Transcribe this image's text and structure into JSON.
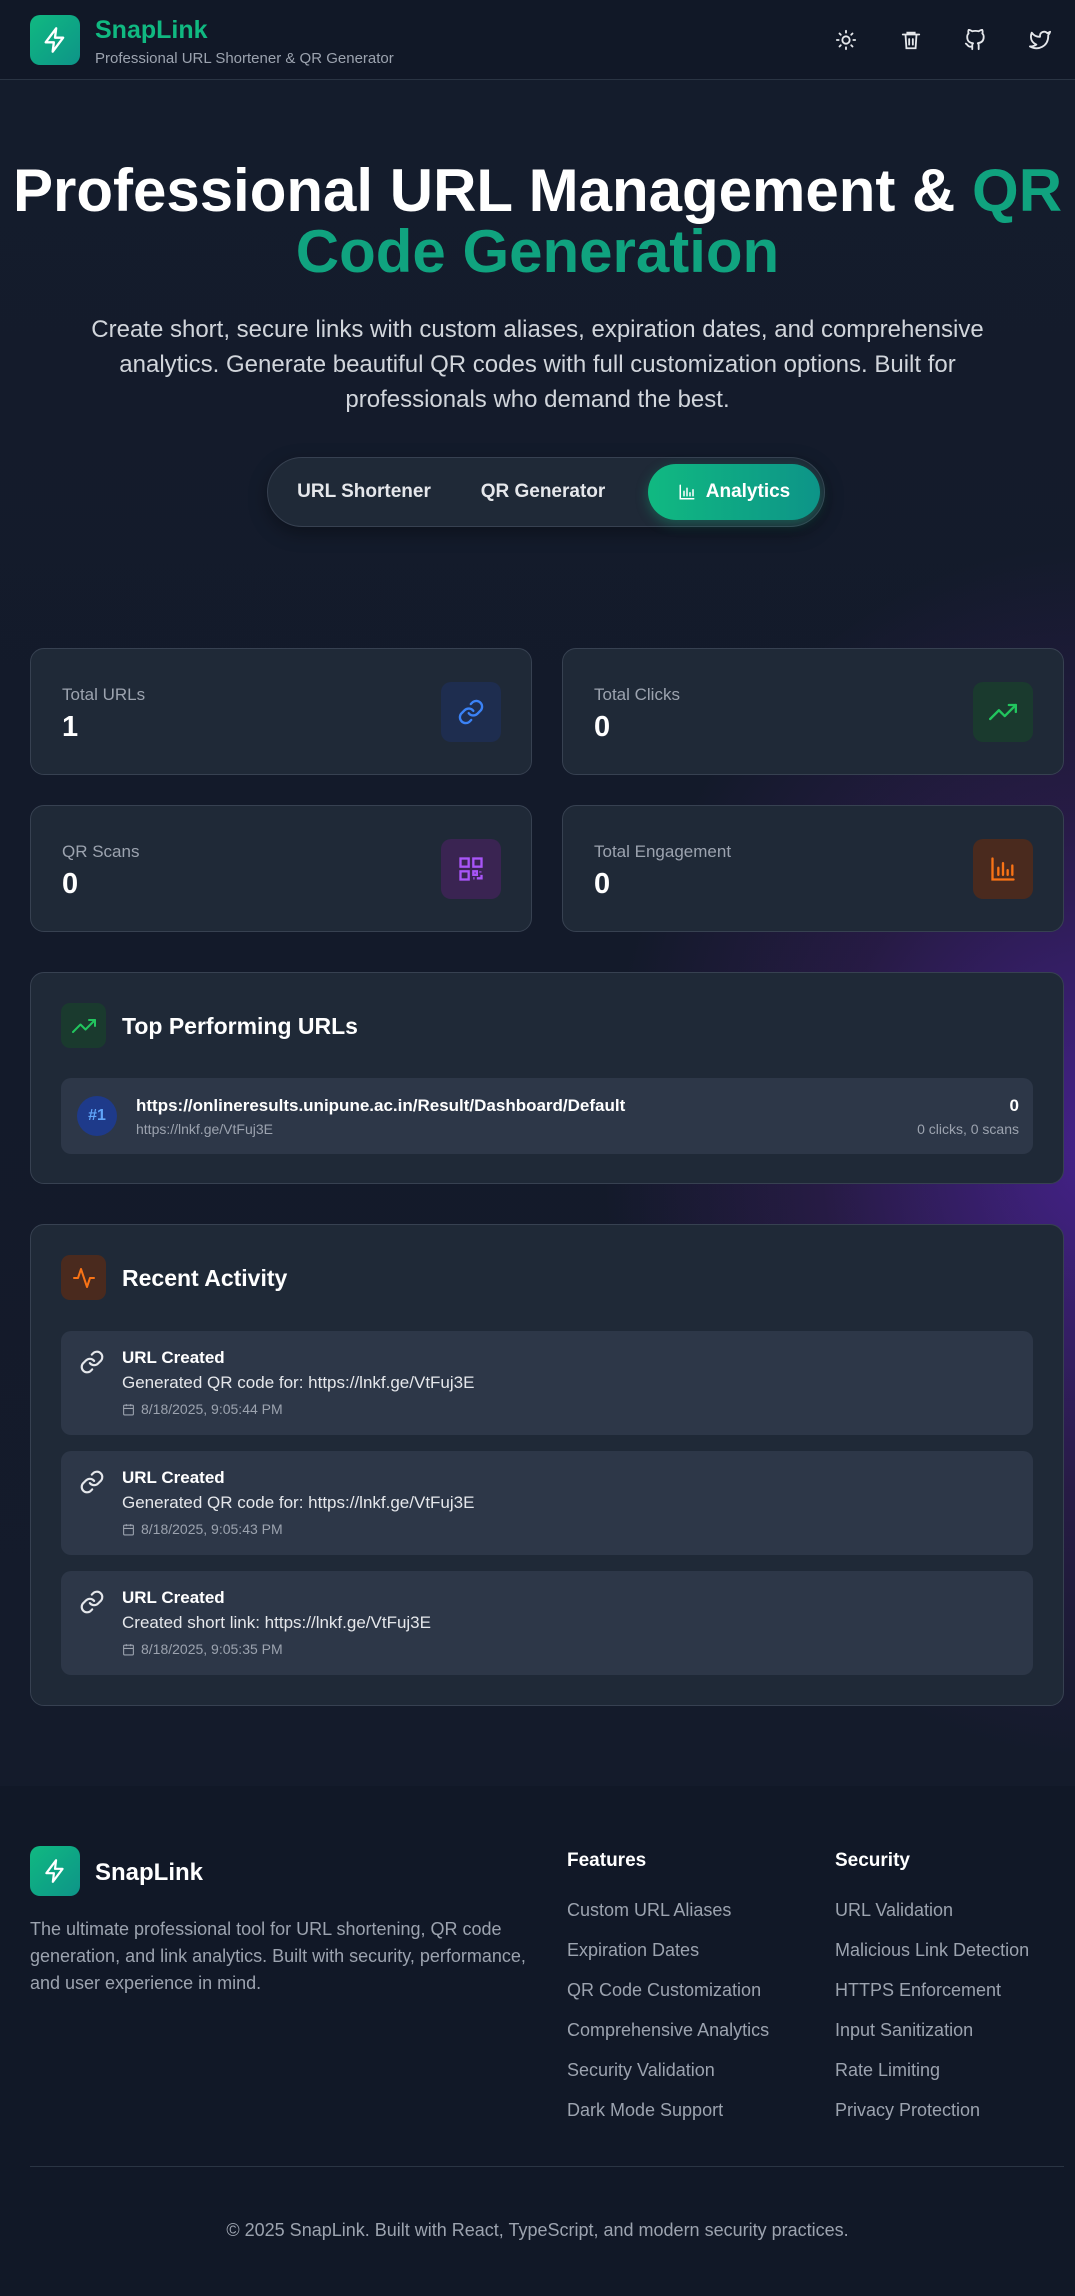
{
  "header": {
    "app_name": "SnapLink",
    "tagline": "Professional URL Shortener & QR Generator",
    "icons": [
      "sun-icon",
      "trash-icon",
      "github-icon",
      "twitter-icon"
    ]
  },
  "hero": {
    "title_main": "Professional URL Management & ",
    "title_accent": "QR Code Generation",
    "description": "Create short, secure links with custom aliases, expiration dates, and comprehensive analytics. Generate beautiful QR codes with full customization options. Built for professionals who demand the best."
  },
  "tabs": [
    {
      "label": "URL Shortener",
      "active": false
    },
    {
      "label": "QR Generator",
      "active": false
    },
    {
      "label": "Analytics",
      "active": true,
      "icon": "bar-chart-icon"
    }
  ],
  "stats": [
    {
      "label": "Total URLs",
      "value": "1",
      "icon": "link-icon",
      "color": "#3b82f6"
    },
    {
      "label": "Total Clicks",
      "value": "0",
      "icon": "trending-up-icon",
      "color": "#22c55e"
    },
    {
      "label": "QR Scans",
      "value": "0",
      "icon": "qr-code-icon",
      "color": "#a855f7"
    },
    {
      "label": "Total Engagement",
      "value": "0",
      "icon": "bar-chart-icon",
      "color": "#f97316"
    }
  ],
  "top_urls": {
    "title": "Top Performing URLs",
    "items": [
      {
        "rank": "#1",
        "url": "https://onlineresults.unipune.ac.in/Result/Dashboard/Default",
        "short": "https://lnkf.ge/VtFuj3E",
        "count": "0",
        "detail": "0 clicks, 0 scans"
      }
    ]
  },
  "activity": {
    "title": "Recent Activity",
    "items": [
      {
        "title": "URL Created",
        "desc": "Generated QR code for: https://lnkf.ge/VtFuj3E",
        "time": "8/18/2025, 9:05:44 PM"
      },
      {
        "title": "URL Created",
        "desc": "Generated QR code for: https://lnkf.ge/VtFuj3E",
        "time": "8/18/2025, 9:05:43 PM"
      },
      {
        "title": "URL Created",
        "desc": "Created short link: https://lnkf.ge/VtFuj3E",
        "time": "8/18/2025, 9:05:35 PM"
      }
    ]
  },
  "footer": {
    "brand": "SnapLink",
    "description": "The ultimate professional tool for URL shortening, QR code generation, and link analytics. Built with security, performance, and user experience in mind.",
    "features_title": "Features",
    "features": [
      "Custom URL Aliases",
      "Expiration Dates",
      "QR Code Customization",
      "Comprehensive Analytics",
      "Security Validation",
      "Dark Mode Support"
    ],
    "security_title": "Security",
    "security": [
      "URL Validation",
      "Malicious Link Detection",
      "HTTPS Enforcement",
      "Input Sanitization",
      "Rate Limiting",
      "Privacy Protection"
    ],
    "copyright": "© 2025 SnapLink. Built with React, TypeScript, and modern security practices."
  }
}
